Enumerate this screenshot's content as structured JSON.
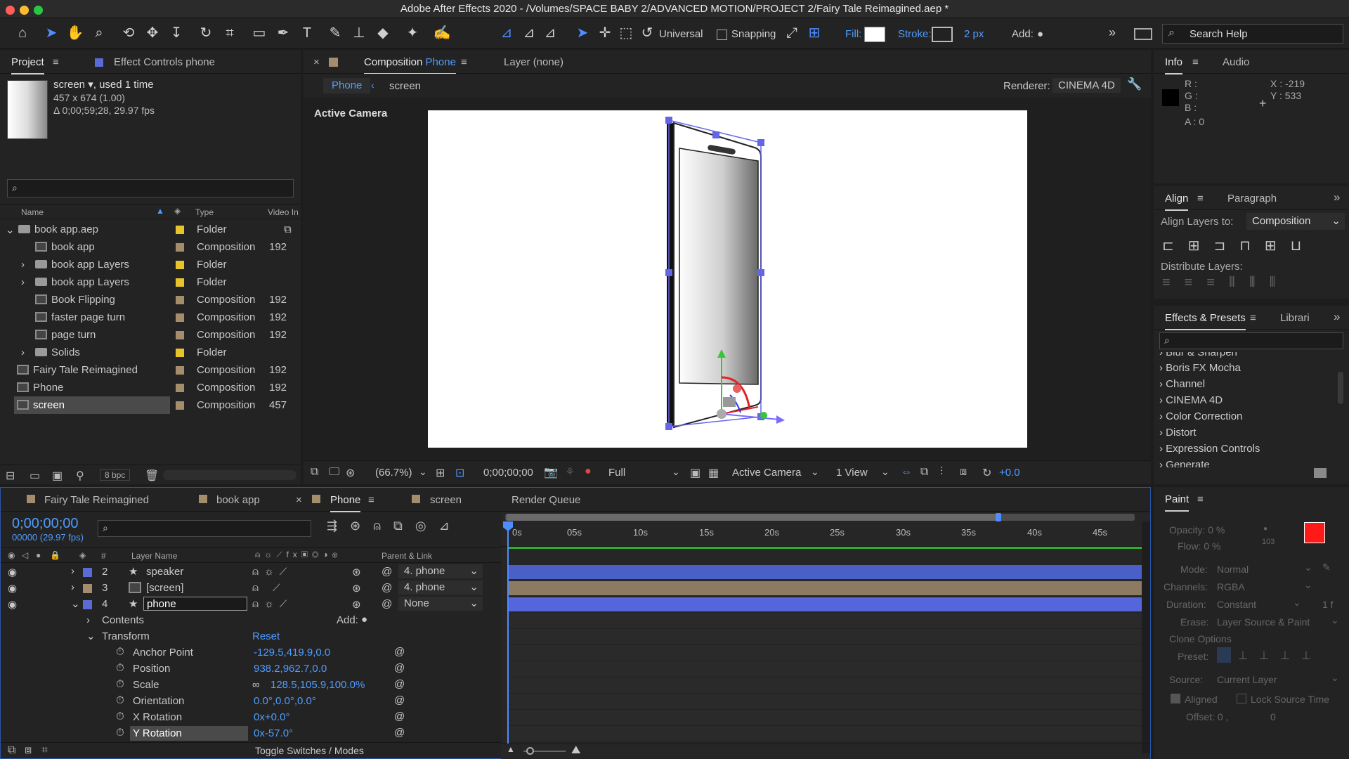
{
  "menubar": {
    "app_title": "Adobe After Effects 2020 - /Volumes/SPACE BABY 2/ADVANCED MOTION/PROJECT 2/Fairy Tale Reimagined.aep *"
  },
  "toolbar": {
    "universal_label": "Universal",
    "snapping_label": "Snapping",
    "fill_label": "Fill:",
    "stroke_label": "Stroke:",
    "stroke_width": "2 px",
    "add_label": "Add:",
    "search_help": "Search Help"
  },
  "project_panel": {
    "tab_project": "Project",
    "tab_effect_controls": "Effect Controls phone",
    "selected_name": "screen",
    "selected_used": ", used 1 time",
    "selected_dims": "457 x 674 (1.00)",
    "selected_duration": "Δ 0;00;59;28, 29.97 fps",
    "col_name": "Name",
    "col_type": "Type",
    "col_video": "Video In",
    "bpc": "8 bpc",
    "items": [
      {
        "name": "book app.aep",
        "type": "Folder",
        "vin": ""
      },
      {
        "name": "book app",
        "type": "Composition",
        "vin": "192"
      },
      {
        "name": "book app Layers",
        "type": "Folder",
        "vin": ""
      },
      {
        "name": "book app Layers",
        "type": "Folder",
        "vin": ""
      },
      {
        "name": "Book Flipping",
        "type": "Composition",
        "vin": "192"
      },
      {
        "name": "faster page turn",
        "type": "Composition",
        "vin": "192"
      },
      {
        "name": "page turn",
        "type": "Composition",
        "vin": "192"
      },
      {
        "name": "Solids",
        "type": "Folder",
        "vin": ""
      },
      {
        "name": "Fairy Tale Reimagined",
        "type": "Composition",
        "vin": "192"
      },
      {
        "name": "Phone",
        "type": "Composition",
        "vin": "192"
      },
      {
        "name": "screen",
        "type": "Composition",
        "vin": "457"
      }
    ]
  },
  "comp_panel": {
    "tab_composition": "Composition",
    "tab_comp_name": "Phone",
    "tab_layer": "Layer (none)",
    "crumb_phone": "Phone",
    "crumb_screen": "screen",
    "renderer_label": "Renderer:",
    "renderer_value": "CINEMA 4D",
    "active_camera": "Active Camera",
    "zoom": "(66.7%)",
    "timecode": "0;00;00;00",
    "resolution": "Full",
    "camera_select": "Active Camera",
    "views": "1 View",
    "exposure": "+0.0"
  },
  "info_panel": {
    "tab_info": "Info",
    "tab_audio": "Audio",
    "r": "R :",
    "g": "G :",
    "b": "B :",
    "a": "A :  0",
    "x": "X : -219",
    "y": "Y :  533"
  },
  "align_panel": {
    "tab_align": "Align",
    "tab_paragraph": "Paragraph",
    "align_to_label": "Align Layers to:",
    "align_to_value": "Composition",
    "distribute_label": "Distribute Layers:"
  },
  "effects_panel": {
    "tab_effects": "Effects & Presets",
    "tab_libraries": "Librari",
    "items": [
      "Blur & Sharpen",
      "Boris FX Mocha",
      "Channel",
      "CINEMA 4D",
      "Color Correction",
      "Distort",
      "Expression Controls",
      "Generate"
    ]
  },
  "timeline": {
    "tabs": [
      "Fairy Tale Reimagined",
      "book app",
      "Phone",
      "screen",
      "Render Queue"
    ],
    "timecode": "0;00;00;00",
    "frame": "00000 (29.97 fps)",
    "col_num": "#",
    "col_layer_name": "Layer Name",
    "col_parent": "Parent & Link",
    "ruler": [
      "0s",
      "05s",
      "10s",
      "15s",
      "20s",
      "25s",
      "30s",
      "35s",
      "40s",
      "45s"
    ],
    "layers": [
      {
        "num": "2",
        "name": "speaker",
        "parent": "4. phone"
      },
      {
        "num": "3",
        "name": "[screen]",
        "parent": "4. phone"
      },
      {
        "num": "4",
        "name": "phone",
        "parent": "None"
      }
    ],
    "contents_label": "Contents",
    "add_label": "Add:",
    "transform_label": "Transform",
    "reset_label": "Reset",
    "properties": [
      {
        "name": "Anchor Point",
        "value": "-129.5,419.9,0.0"
      },
      {
        "name": "Position",
        "value": "938.2,962.7,0.0"
      },
      {
        "name": "Scale",
        "value": "128.5,105.9,100.0%"
      },
      {
        "name": "Orientation",
        "value": "0.0°,0.0°,0.0°"
      },
      {
        "name": "X Rotation",
        "value": "0x+0.0°"
      },
      {
        "name": "Y Rotation",
        "value": "0x-57.0°"
      }
    ],
    "toggle_label": "Toggle Switches / Modes"
  },
  "paint_panel": {
    "title": "Paint",
    "opacity": "Opacity:  0 %",
    "flow": "Flow:  0 %",
    "brush_size": "103",
    "mode_label": "Mode:",
    "mode_value": "Normal",
    "channels_label": "Channels:",
    "channels_value": "RGBA",
    "duration_label": "Duration:",
    "duration_value": "Constant",
    "duration_frames": "1  f",
    "erase_label": "Erase:",
    "erase_value": "Layer Source & Paint",
    "clone_options": "Clone Options",
    "preset_label": "Preset:",
    "source_label": "Source:",
    "source_value": "Current Layer",
    "aligned": "Aligned",
    "lock_source": "Lock Source Time",
    "offset": "Offset:  0 ,",
    "offset_y": "0"
  },
  "colors": {
    "accent": "#4f8cff",
    "layer_blue": "#4b5fc8",
    "label_tan": "#a58c6c",
    "folder_yellow": "#e6c52b",
    "paint_red": "#ff1a1a"
  }
}
